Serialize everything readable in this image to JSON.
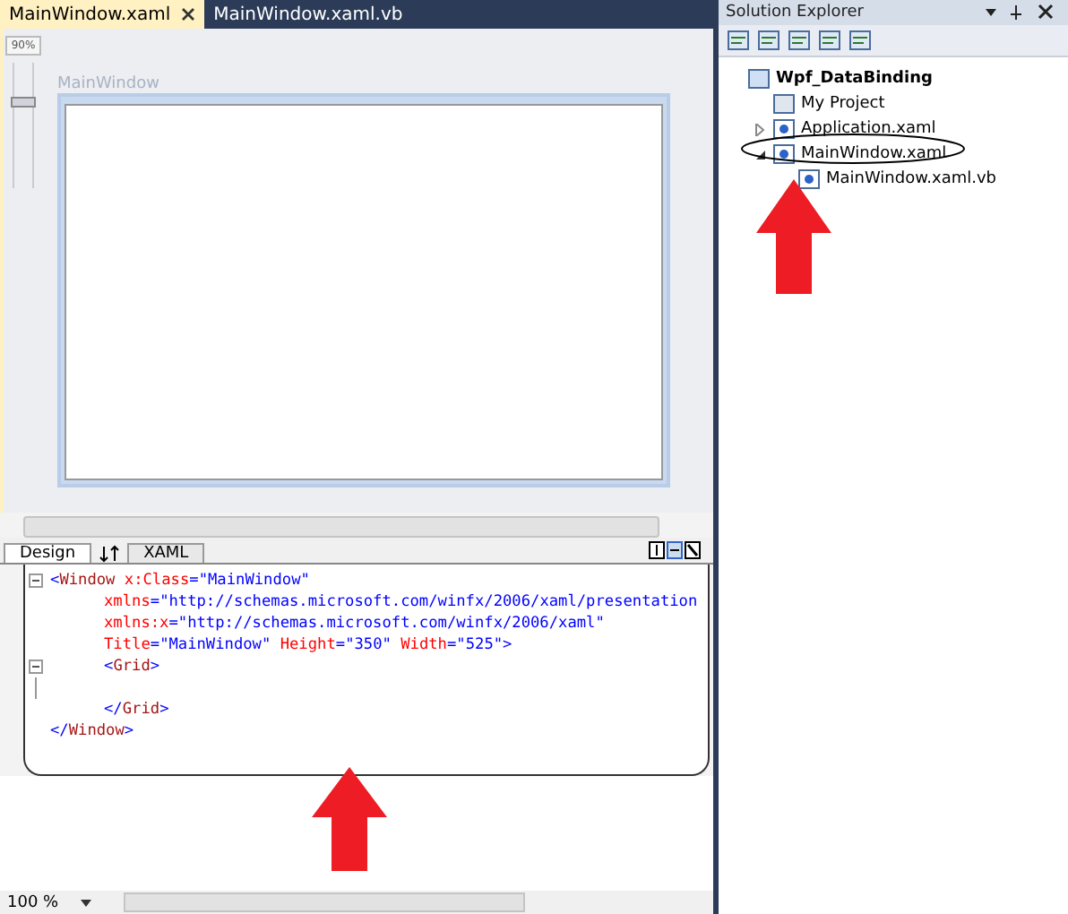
{
  "tabs": [
    {
      "label": "MainWindow.xaml",
      "selected": true,
      "closable": true
    },
    {
      "label": "MainWindow.xaml.vb",
      "selected": false,
      "closable": false
    }
  ],
  "designer": {
    "zoom": "90%",
    "zoom_slider": {
      "level": 0.7
    },
    "window_title": "MainWindow"
  },
  "view_tabs": [
    {
      "label": "Design",
      "selected": true
    },
    {
      "label": "XAML",
      "selected": false
    }
  ],
  "code_lines": [
    {
      "fold": true,
      "segments": [
        {
          "kind": "punct",
          "text": "<"
        },
        {
          "kind": "tag",
          "text": "Window"
        },
        {
          "kind": "attr",
          "text": " x:Class"
        },
        {
          "kind": "punct",
          "text": "="
        },
        {
          "kind": "value",
          "text": "\"MainWindow\""
        }
      ],
      "children": [
        {
          "fold": false,
          "segments": [
            {
              "kind": "attr",
              "text": "xmlns"
            },
            {
              "kind": "punct",
              "text": "="
            },
            {
              "kind": "value",
              "text": "\"http://schemas.microsoft.com/winfx/2006/xaml/presentation"
            }
          ]
        },
        {
          "fold": false,
          "segments": [
            {
              "kind": "attr",
              "text": "xmlns:x"
            },
            {
              "kind": "punct",
              "text": "="
            },
            {
              "kind": "value",
              "text": "\"http://schemas.microsoft.com/winfx/2006/xaml\""
            }
          ]
        },
        {
          "fold": false,
          "segments": [
            {
              "kind": "attr",
              "text": "Title"
            },
            {
              "kind": "punct",
              "text": "="
            },
            {
              "kind": "value",
              "text": "\"MainWindow\""
            },
            {
              "kind": "attr",
              "text": " Height"
            },
            {
              "kind": "punct",
              "text": "="
            },
            {
              "kind": "value",
              "text": "\"350\""
            },
            {
              "kind": "attr",
              "text": " Width"
            },
            {
              "kind": "punct",
              "text": "="
            },
            {
              "kind": "value",
              "text": "\"525\""
            },
            {
              "kind": "punct",
              "text": ">"
            }
          ]
        },
        {
          "fold": true,
          "segments": [
            {
              "kind": "punct",
              "text": "<"
            },
            {
              "kind": "tag",
              "text": "Grid"
            },
            {
              "kind": "punct",
              "text": ">"
            }
          ]
        },
        {
          "kind": "blank"
        },
        {
          "fold": false,
          "segments": [
            {
              "kind": "punct",
              "text": "</"
            },
            {
              "kind": "tag",
              "text": "Grid"
            },
            {
              "kind": "punct",
              "text": ">"
            }
          ]
        }
      ]
    },
    {
      "fold": false,
      "segments": [
        {
          "kind": "punct",
          "text": "</"
        },
        {
          "kind": "tag",
          "text": "Window"
        },
        {
          "kind": "punct",
          "text": ">"
        }
      ]
    }
  ],
  "zoom_level": "100 %",
  "solution_explorer": {
    "title": "Solution Explorer",
    "tree": [
      {
        "label": "Wpf_DataBinding",
        "kind": "project",
        "children": [
          {
            "label": "My Project",
            "kind": "folder"
          },
          {
            "label": "Application.xaml",
            "kind": "xaml",
            "expanded": false
          },
          {
            "label": "MainWindow.xaml",
            "kind": "xaml",
            "expanded": true,
            "children": [
              {
                "label": "MainWindow.xaml.vb",
                "kind": "vb"
              }
            ]
          }
        ]
      }
    ]
  }
}
